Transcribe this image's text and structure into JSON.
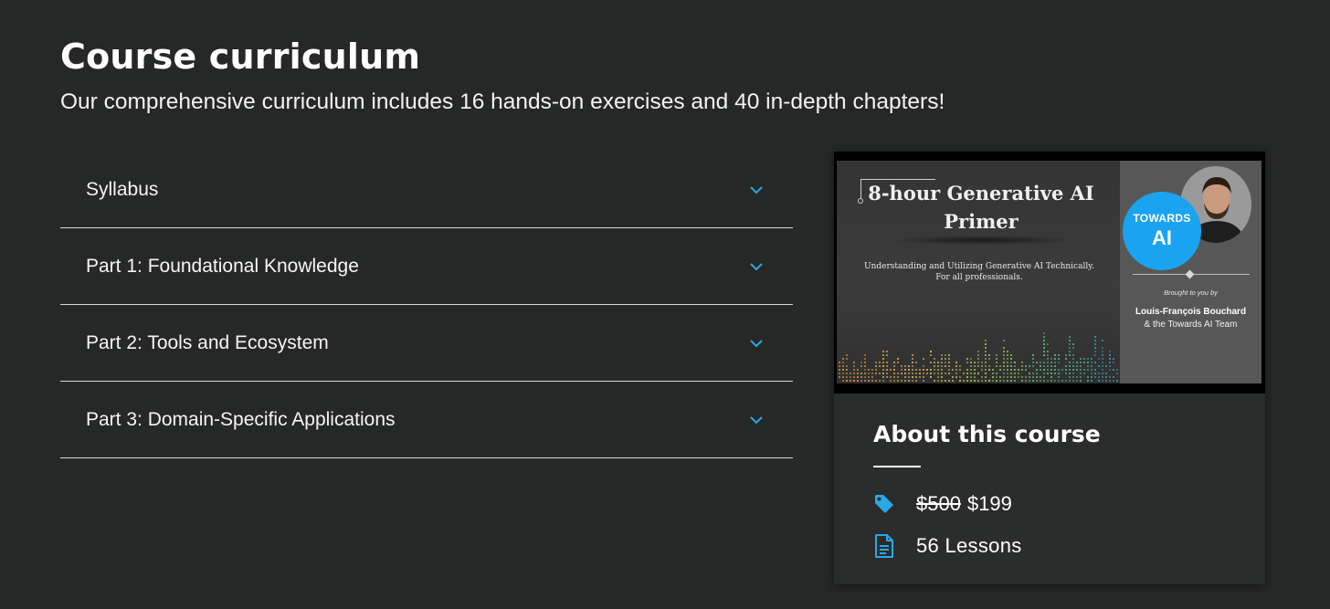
{
  "header": {
    "title": "Course curriculum",
    "subtitle": "Our comprehensive curriculum includes 16 hands-on exercises and 40 in-depth chapters!"
  },
  "accordion": {
    "items": [
      {
        "label": "Syllabus"
      },
      {
        "label": "Part 1: Foundational Knowledge"
      },
      {
        "label": "Part 2: Tools and Ecosystem"
      },
      {
        "label": "Part 3: Domain-Specific Applications"
      }
    ],
    "chevron_icon": "chevron-down-icon",
    "chevron_color": "#29a9e6"
  },
  "course_card": {
    "thumbnail": {
      "title": "8-hour Generative AI Primer",
      "subtitle_line1": "Understanding and Utilizing Generative AI Technically.",
      "subtitle_line2": "For all professionals.",
      "logo_line1": "TOWARDS",
      "logo_line2": "AI",
      "brought_by": "Brought to you by",
      "author": "Louis-François Bouchard",
      "team": "&  the Towards AI Team"
    },
    "about_title": "About this course",
    "price": {
      "icon": "price-tag-icon",
      "old": "$500",
      "new": "$199"
    },
    "lessons": {
      "icon": "document-icon",
      "text": "56 Lessons"
    },
    "accent_color": "#29a9e6"
  }
}
